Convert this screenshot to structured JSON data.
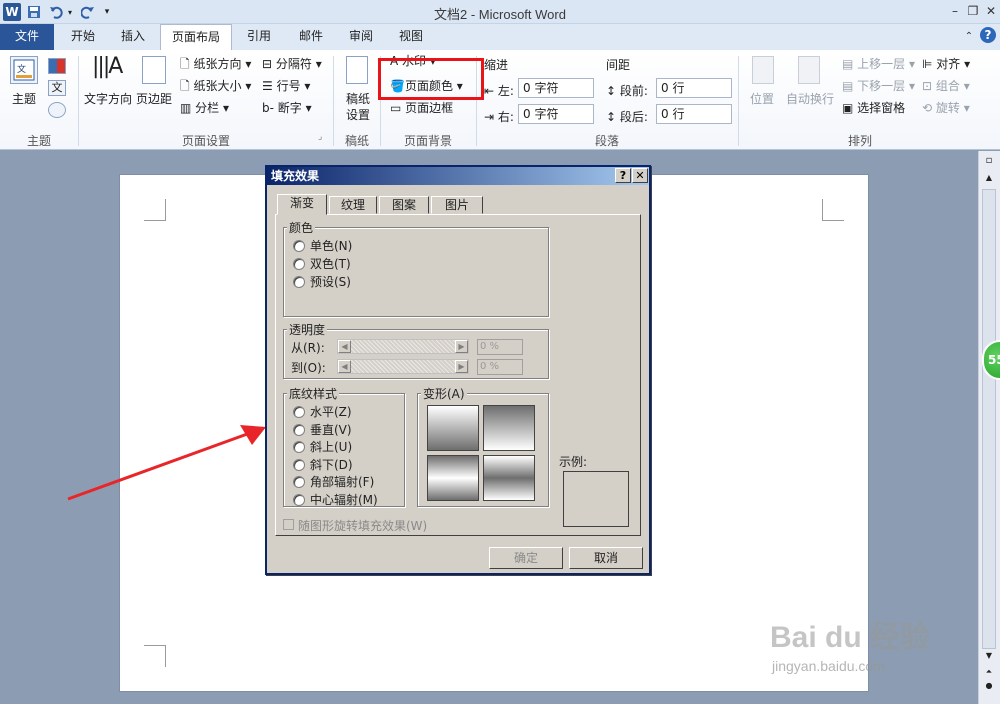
{
  "titlebar": {
    "title": "文档2 - Microsoft Word",
    "logo": "W"
  },
  "tabs": [
    "文件",
    "开始",
    "插入",
    "页面布局",
    "引用",
    "邮件",
    "审阅",
    "视图"
  ],
  "ribbon": {
    "theme_group": {
      "theme_label": "主题",
      "group_label": "主题"
    },
    "page_setup": {
      "text_direction": "文字方向",
      "margins": "页边距",
      "orientation": "纸张方向",
      "size": "纸张大小",
      "columns": "分栏",
      "breaks": "分隔符",
      "line_numbers": "行号",
      "hyphenation": "断字",
      "group_label": "页面设置"
    },
    "draft": {
      "label_line1": "稿纸",
      "label_line2": "设置",
      "group_label": "稿纸"
    },
    "page_background": {
      "watermark": "水印",
      "page_color": "页面颜色",
      "page_borders": "页面边框",
      "group_label": "页面背景"
    },
    "paragraph": {
      "indent_title": "缩进",
      "spacing_title": "间距",
      "left_label": "左:",
      "left_value": "0 字符",
      "right_label": "右:",
      "right_value": "0 字符",
      "before_label": "段前:",
      "before_value": "0 行",
      "after_label": "段后:",
      "after_value": "0 行",
      "group_label": "段落"
    },
    "arrange": {
      "position": "位置",
      "wrap_text": "自动换行",
      "bring_forward": "上移一层",
      "send_backward": "下移一层",
      "selection_pane": "选择窗格",
      "align": "对齐",
      "group": "组合",
      "rotate": "旋转",
      "group_label": "排列"
    }
  },
  "dialog": {
    "title": "填充效果",
    "help_btn": "?",
    "close_btn": "✕",
    "tabs": [
      "渐变",
      "纹理",
      "图案",
      "图片"
    ],
    "colors_legend": "颜色",
    "color_options": [
      "单色(N)",
      "双色(T)",
      "预设(S)"
    ],
    "transparency_legend": "透明度",
    "from_label": "从(R):",
    "to_label": "到(O):",
    "from_value": "0 %",
    "to_value": "0 %",
    "shading_legend": "底纹样式",
    "shading_options": [
      "水平(Z)",
      "垂直(V)",
      "斜上(U)",
      "斜下(D)",
      "角部辐射(F)",
      "中心辐射(M)"
    ],
    "variants_label": "变形(A)",
    "sample_label": "示例:",
    "rotate_checkbox": "随图形旋转填充效果(W)",
    "ok": "确定",
    "cancel": "取消"
  },
  "side_badge": "55",
  "watermark": {
    "brand": "Bai du 经验",
    "url": "jingyan.baidu.com"
  },
  "colors": {
    "file_tab": "#2a5699",
    "highlight": "#e8141a",
    "arrow": "#e8262a",
    "dialog_title": "#0a246a"
  }
}
